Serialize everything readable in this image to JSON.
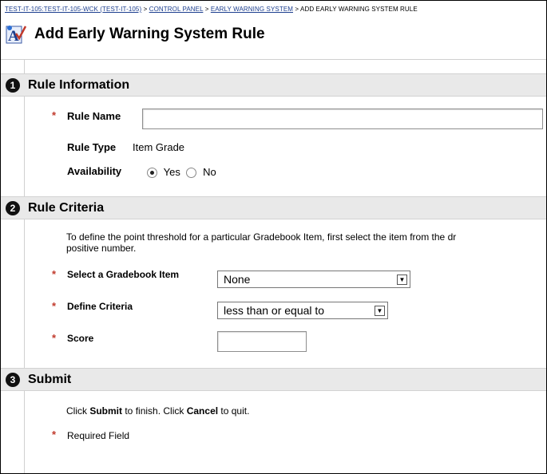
{
  "breadcrumb": {
    "item1": "TEST-IT-105:TEST-IT-105-WCK (TEST-IT-105)",
    "sep": ">",
    "item2": "CONTROL PANEL",
    "item3": "EARLY WARNING SYSTEM",
    "current": "ADD EARLY WARNING SYSTEM RULE"
  },
  "page_title": "Add Early Warning System Rule",
  "steps": {
    "s1": {
      "number": "1",
      "title": "Rule Information"
    },
    "s2": {
      "number": "2",
      "title": "Rule Criteria"
    },
    "s3": {
      "number": "3",
      "title": "Submit"
    }
  },
  "rule_info": {
    "rule_name_label": "Rule Name",
    "rule_name_value": "",
    "rule_type_label": "Rule Type",
    "rule_type_value": "Item Grade",
    "availability_label": "Availability",
    "yes_label": "Yes",
    "no_label": "No",
    "selected": "Yes"
  },
  "rule_criteria": {
    "description_line1": "To define the point threshold for a particular Gradebook Item, first select the item from the dr",
    "description_line2": "positive number.",
    "gradebook_label": "Select a Gradebook Item",
    "gradebook_value": "None",
    "criteria_label": "Define Criteria",
    "criteria_value": "less than or equal to",
    "score_label": "Score",
    "score_value": ""
  },
  "submit": {
    "text_pre": "Click ",
    "submit_word": "Submit",
    "text_mid": " to finish. Click ",
    "cancel_word": "Cancel",
    "text_post": " to quit.",
    "required_label": "Required Field"
  },
  "required_marker": "*",
  "colors": {
    "required": "#c0392b",
    "link": "#1d3f8f",
    "step_bar": "#e9e9e9"
  }
}
